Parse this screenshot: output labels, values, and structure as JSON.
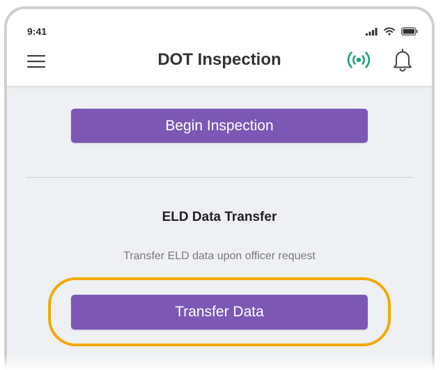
{
  "status_bar": {
    "time": "9:41",
    "icons": [
      "cellular-signal-icon",
      "wifi-icon",
      "battery-icon"
    ]
  },
  "app_bar": {
    "menu_icon": "hamburger-menu-icon",
    "title": "DOT Inspection",
    "connection_icon": "broadcast-signal-icon",
    "notification_icon": "bell-icon"
  },
  "inspection": {
    "begin_label": "Begin Inspection"
  },
  "eld_transfer": {
    "title": "ELD Data Transfer",
    "description": "Transfer ELD data upon officer request",
    "transfer_label": "Transfer Data"
  },
  "colors": {
    "primary": "#7c58b4",
    "highlight": "#f5a800",
    "connected": "#1aa37a",
    "background": "#eef0f3"
  }
}
